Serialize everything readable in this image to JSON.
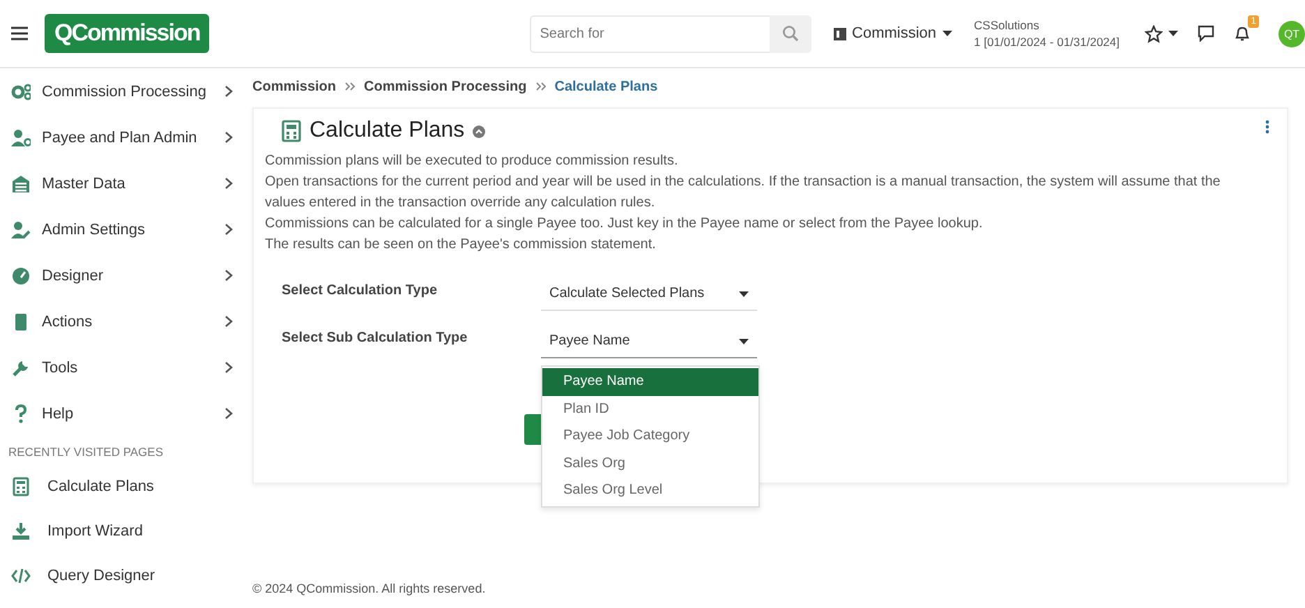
{
  "header": {
    "brand": "QCommission",
    "search": {
      "placeholder": "Search for"
    },
    "module": "Commission",
    "company": "CSSolutions",
    "period": "1 [01/01/2024 - 01/31/2024]",
    "notification_count": "1",
    "avatar": "QT"
  },
  "sidebar": {
    "items": [
      {
        "label": "Commission Processing"
      },
      {
        "label": "Payee and Plan Admin"
      },
      {
        "label": "Master Data"
      },
      {
        "label": "Admin Settings"
      },
      {
        "label": "Designer"
      },
      {
        "label": "Actions"
      },
      {
        "label": "Tools"
      },
      {
        "label": "Help"
      }
    ],
    "recent_heading": "RECENTLY VISITED PAGES",
    "recent": [
      {
        "label": "Calculate Plans"
      },
      {
        "label": "Import Wizard"
      },
      {
        "label": "Query Designer"
      }
    ]
  },
  "breadcrumb": [
    {
      "label": "Commission",
      "current": false
    },
    {
      "label": "Commission Processing",
      "current": false
    },
    {
      "label": "Calculate Plans",
      "current": true
    }
  ],
  "page": {
    "title": "Calculate Plans",
    "description": [
      "Commission plans will be executed to produce commission results.",
      "Open transactions for the current period and year will be used in the calculations. If the transaction is a manual transaction, the system will assume that the values entered in the transaction override any calculation rules.",
      "Commissions can be calculated for a single Payee too. Just key in the Payee name or select from the Payee lookup.",
      "The results can be seen on the Payee's commission statement."
    ]
  },
  "form": {
    "fields": [
      {
        "label": "Select Calculation Type",
        "value": "Calculate Selected Plans",
        "expanded": false
      },
      {
        "label": "Select Sub Calculation Type",
        "value": "Payee Name",
        "expanded": true,
        "options": [
          {
            "label": "Payee Name",
            "selected": true
          },
          {
            "label": "Plan ID",
            "selected": false
          },
          {
            "label": "Payee Job Category",
            "selected": false
          },
          {
            "label": "Sales Org",
            "selected": false
          },
          {
            "label": "Sales Org Level",
            "selected": false
          }
        ]
      }
    ]
  },
  "footer": "© 2024 QCommission. All rights reserved."
}
